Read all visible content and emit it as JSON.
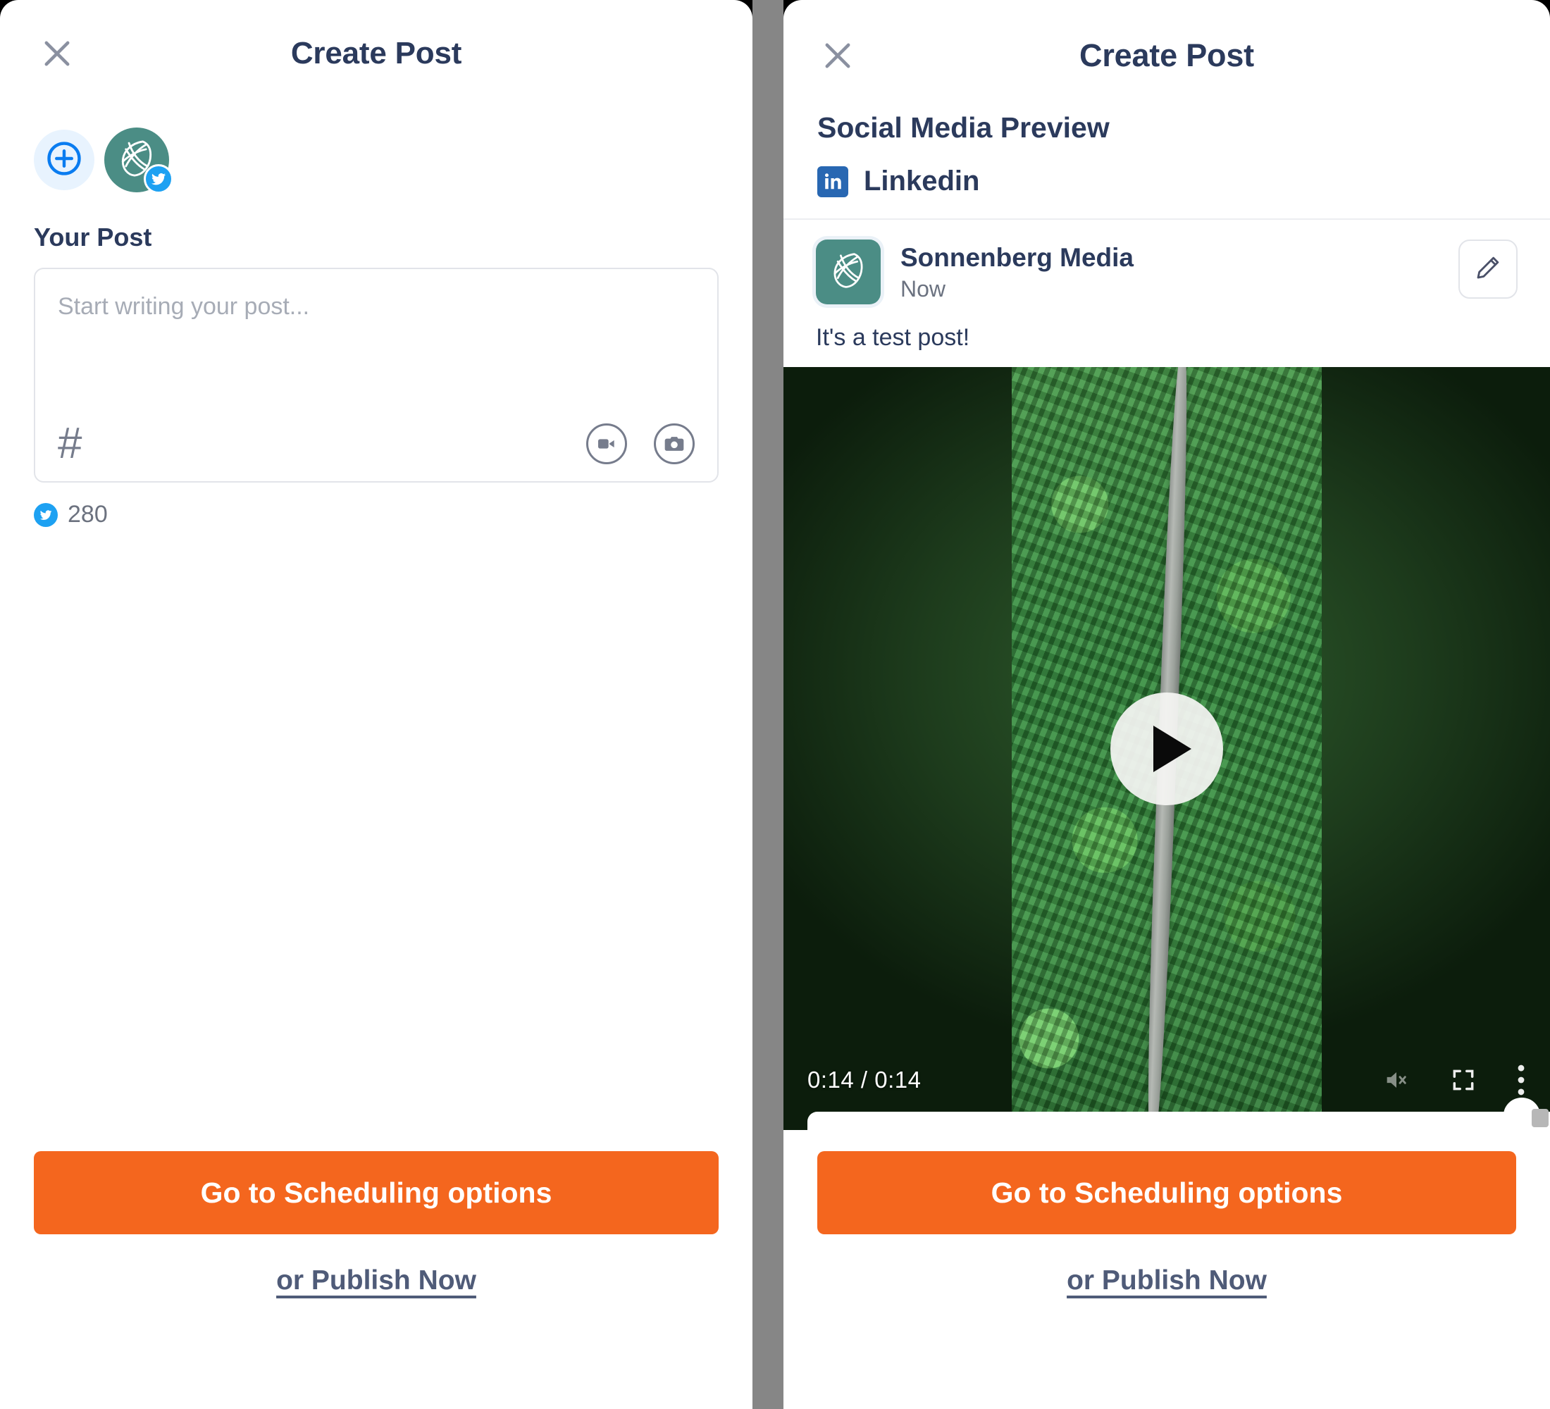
{
  "app": {
    "title": "Create Post",
    "close_icon": "close-icon"
  },
  "left_panel": {
    "title": "Create Post",
    "add_account_icon": "plus-circle-icon",
    "account": {
      "avatar_icon": "sonnenberg-leaf-logo",
      "network_badge_icon": "twitter-bird-icon"
    },
    "section_label": "Your Post",
    "composer": {
      "placeholder": "Start writing your post...",
      "value": "",
      "hashtag_icon": "#",
      "video_icon": "video-camera-icon",
      "photo_icon": "camera-icon"
    },
    "character_counter": {
      "network_icon": "twitter-bird-icon",
      "value": "280"
    }
  },
  "right_panel": {
    "title": "Create Post",
    "preview_heading": "Social Media Preview",
    "network": {
      "icon": "linkedin-icon",
      "label": "Linkedin"
    },
    "post": {
      "avatar_icon": "sonnenberg-leaf-logo",
      "author": "Sonnenberg Media",
      "timestamp": "Now",
      "edit_icon": "pencil-icon",
      "body": "It's a test post!"
    },
    "video": {
      "play_icon": "play-icon",
      "time": "0:14 / 0:14",
      "mute_icon": "volume-mute-icon",
      "fullscreen_icon": "fullscreen-icon",
      "more_icon": "kebab-menu-icon"
    }
  },
  "footer": {
    "primary_label": "Go to Scheduling options",
    "secondary_label": "or Publish Now"
  },
  "colors": {
    "accent_orange": "#f4661e",
    "brand_navy": "#2b3a5c",
    "brand_teal": "#4b8d85",
    "twitter_blue": "#1da1f2",
    "linkedin_blue": "#2867b2"
  }
}
